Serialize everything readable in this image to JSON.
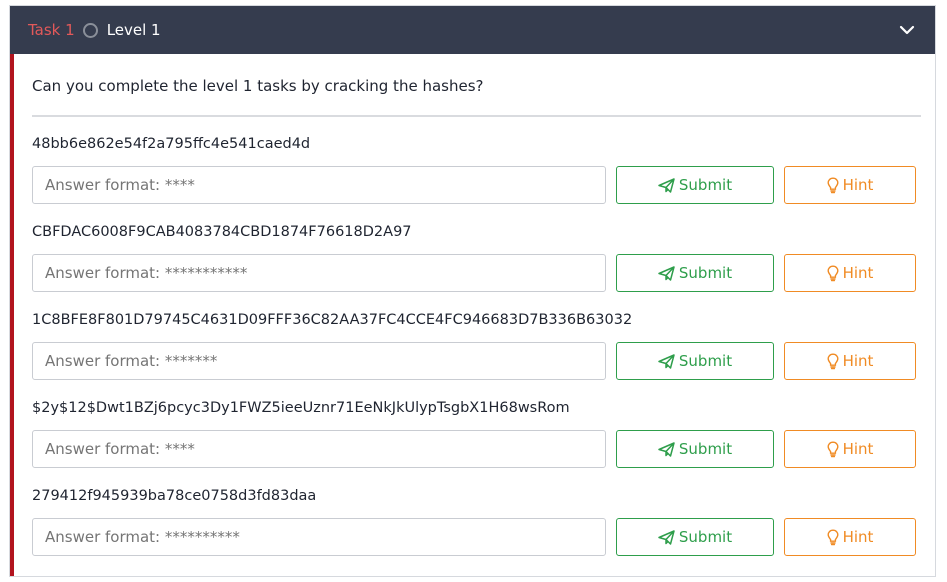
{
  "header": {
    "task_label": "Task 1",
    "title": "Level 1"
  },
  "question": "Can you complete the level 1 tasks by cracking the hashes?",
  "submit_label": "Submit",
  "hint_label": "Hint",
  "items": [
    {
      "hash": "48bb6e862e54f2a795ffc4e541caed4d",
      "placeholder": "Answer format: ****"
    },
    {
      "hash": "CBFDAC6008F9CAB4083784CBD1874F76618D2A97",
      "placeholder": "Answer format: ***********"
    },
    {
      "hash": "1C8BFE8F801D79745C4631D09FFF36C82AA37FC4CCE4FC946683D7B336B63032",
      "placeholder": "Answer format: *******"
    },
    {
      "hash": "$2y$12$Dwt1BZj6pcyc3Dy1FWZ5ieeUznr71EeNkJkUlypTsgbX1H68wsRom",
      "placeholder": "Answer format: ****"
    },
    {
      "hash": "279412f945939ba78ce0758d3fd83daa",
      "placeholder": "Answer format: **********"
    }
  ],
  "colors": {
    "header_bg": "#353c4e",
    "task_label": "#e2595a",
    "left_border": "#b2141e",
    "submit": "#2e9e4b",
    "hint": "#f08b24"
  }
}
